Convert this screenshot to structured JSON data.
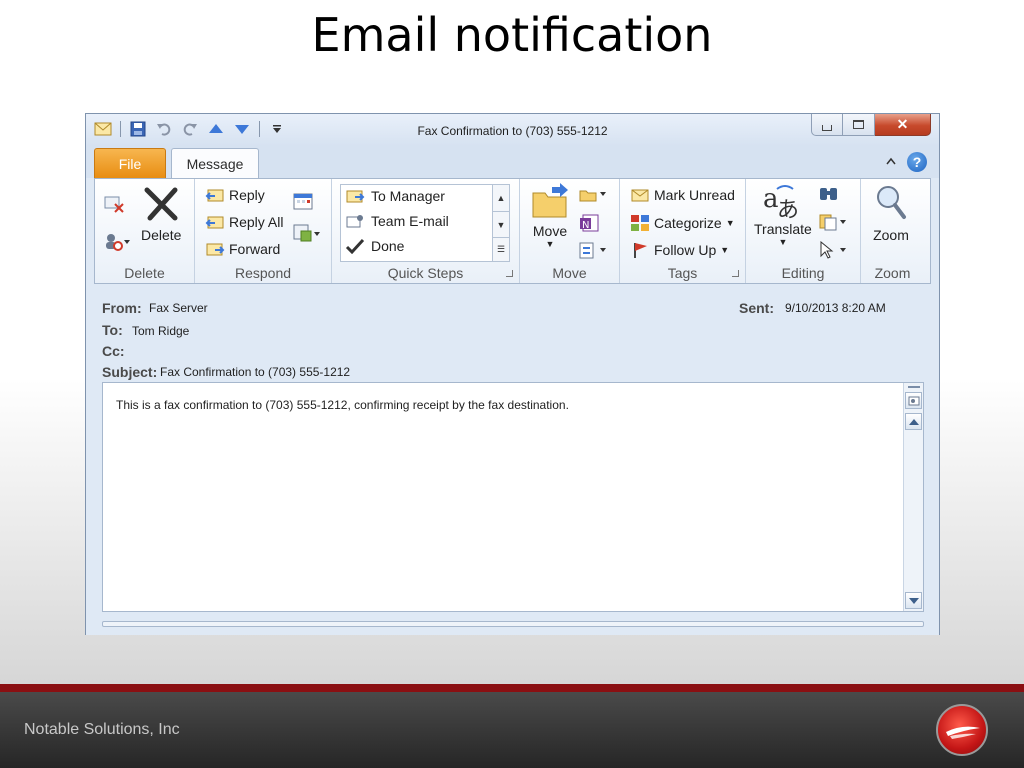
{
  "slide": {
    "title": "Email notification",
    "company": "Notable Solutions, Inc"
  },
  "window": {
    "title": "Fax Confirmation to (703) 555-1212"
  },
  "tabs": {
    "file": "File",
    "message": "Message"
  },
  "ribbon": {
    "delete": {
      "label": "Delete",
      "button": "Delete"
    },
    "respond": {
      "label": "Respond",
      "reply": "Reply",
      "reply_all": "Reply All",
      "forward": "Forward"
    },
    "quick_steps": {
      "label": "Quick Steps",
      "items": [
        "To Manager",
        "Team E-mail",
        "Done"
      ]
    },
    "move": {
      "label": "Move",
      "button": "Move"
    },
    "tags": {
      "label": "Tags",
      "mark_unread": "Mark Unread",
      "categorize": "Categorize",
      "follow_up": "Follow Up"
    },
    "editing": {
      "label": "Editing",
      "translate": "Translate"
    },
    "zoom": {
      "label": "Zoom",
      "button": "Zoom"
    }
  },
  "header": {
    "from_label": "From:",
    "from": "Fax Server",
    "to_label": "To:",
    "to": "Tom Ridge",
    "cc_label": "Cc:",
    "subject_label": "Subject:",
    "subject": "Fax Confirmation to (703) 555-1212",
    "sent_label": "Sent:",
    "sent": "9/10/2013 8:20 AM"
  },
  "body": {
    "text": "This is a fax confirmation to (703) 555-1212, confirming receipt by the fax destination."
  },
  "colors": {
    "accent_file": "#e88d12",
    "close_button": "#c74a2c",
    "footer_red": "#8a0f12"
  }
}
